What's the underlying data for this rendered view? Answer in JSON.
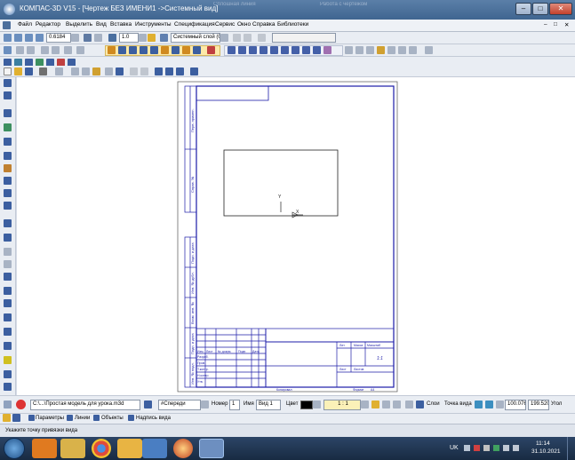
{
  "window": {
    "title": "КОМПАС-3D V15 - [Чертеж БЕЗ ИМЕНИ1 ->Системный вид]",
    "bg_title_left": "Сплошная линия",
    "bg_title_right": "Работа с чертежом",
    "controls": [
      "–",
      "□",
      "✕"
    ],
    "doc_controls": [
      "–",
      "□",
      "✕"
    ]
  },
  "menu": {
    "items": [
      "Файл",
      "Редактор",
      "Выделить",
      "Вид",
      "Вставка",
      "Инструменты",
      "Спецификация",
      "Сервис",
      "Окно",
      "Справка",
      "Библиотеки"
    ]
  },
  "toolbar1": {
    "zoom_value": "0.6184",
    "step_value": "1.0",
    "layer_value": "Системный слой (0)"
  },
  "drawing": {
    "cell_labels": [
      "Изм.",
      "Лист",
      "№ докум.",
      "Подп.",
      "Дата",
      "Разраб.",
      "Пров.",
      "Т.контр.",
      "Н.контр.",
      "Утв."
    ],
    "stamp_labels": [
      "Лит.",
      "Масса",
      "Масштаб",
      "Лист",
      "Листов"
    ],
    "stamp_value": "1:1",
    "bottom_labels": [
      "Копировал",
      "Формат",
      "A4"
    ],
    "side_labels": [
      "Перв. примен.",
      "Справ. №",
      "Подп. и дата",
      "Инв. № дубл.",
      "Взам. инв. №",
      "Подп. и дата",
      "Инв. № подл."
    ],
    "axis_y": "Y",
    "axis_x": "X"
  },
  "bottom_panel": {
    "file_path": "C:\\...\\Простая модель для урока.m3d",
    "orientation": "#Спереди",
    "number_label": "Номер",
    "number_value": "1",
    "name_label": "Имя",
    "name_value": "Вид 1",
    "color_label": "Цвет",
    "scale_value": "1 : 1",
    "layers_label": "Слои",
    "point_label": "Точка вида",
    "x_value": "100.076",
    "y_value": "199.520",
    "angle_label": "Угол"
  },
  "tabs": [
    "Параметры",
    "Линии",
    "Объекты",
    "Надпись вида"
  ],
  "status_text": "Укажите точку привязки вида",
  "taskbar": {
    "lang": "UK",
    "time": "11:14",
    "date": "31.10.2021"
  },
  "colors": {
    "drawing_line": "#1c1ca8",
    "title_bar": "#4a6d98",
    "taskbar": "#1f3350"
  }
}
